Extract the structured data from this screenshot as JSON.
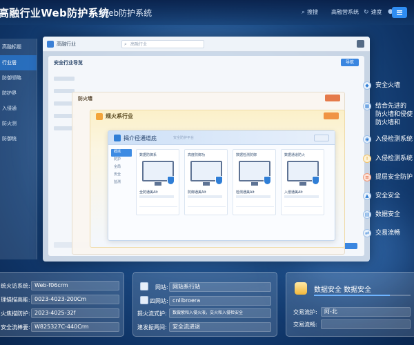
{
  "header": {
    "title": "高融行业Web防护系统",
    "subtitle": "Web防护系统",
    "nav": [
      {
        "icon": "search-icon",
        "label": "搜搜"
      },
      {
        "icon": "",
        "label": "高融营系统"
      },
      {
        "icon": "refresh-icon",
        "label": "速度"
      },
      {
        "icon": "user-icon",
        "label": ""
      }
    ]
  },
  "left_menu": {
    "header": "高融标题",
    "items": [
      "行业居",
      "防御领略",
      "防护界",
      "入侵通",
      "防火测",
      "防御统"
    ]
  },
  "window": {
    "title": "高融行业",
    "search_placeholder": "高融行业",
    "panel1_title": "安全行业导览",
    "panel1_button": "导航",
    "panel2_title": "防火墙",
    "panel3_title": "规火系行业",
    "panel4": {
      "title": "揭介径通道底",
      "subtitle": "安全防护平台",
      "side_items": [
        "概括",
        "防护",
        "全局",
        "安全",
        "监测"
      ],
      "cards": [
        {
          "title": "数据防御系",
          "label": "全防通美Alt"
        },
        {
          "title": "高度防御功",
          "label": "防御通美Alt"
        },
        {
          "title": "数据检测防御",
          "label": "检测通美Alt"
        },
        {
          "title": "数据通道防火",
          "label": "入侵通美Alt"
        }
      ]
    }
  },
  "features": [
    {
      "icon": "shield-icon",
      "label": "安全火墙"
    },
    {
      "icon": "firewall-icon",
      "label": "结合先进的\n防火墙和侵使\n防火墙和"
    },
    {
      "icon": "intrusion-icon",
      "label": "入侵检测系统"
    },
    {
      "icon": "alert-icon",
      "label": "入侵检测系统"
    },
    {
      "icon": "layer-icon",
      "label": "提层安全防护"
    },
    {
      "icon": "lock-icon",
      "label": "安全安全"
    },
    {
      "icon": "data-icon",
      "label": "数据安全"
    },
    {
      "icon": "flow-icon",
      "label": "交易流畅"
    }
  ],
  "info1": {
    "rows": [
      {
        "label": "统火访系统:",
        "value": "Web-f06crm"
      },
      {
        "label": "理描描高能:",
        "value": "0023-4023-200Cm"
      },
      {
        "label": "火焦描防护:",
        "value": "2023-4025-32f"
      },
      {
        "label": "安全流棒要:",
        "value": "W825327C-440Crm"
      }
    ]
  },
  "info2": {
    "rows": [
      {
        "label": "网站:",
        "value": "网站系行站"
      },
      {
        "label": "四网站:",
        "value": "cnlibroera"
      },
      {
        "label": "提火流式护:",
        "value": "数做紫和入侵火液，交火和入侵检安全"
      },
      {
        "label": "建发振两间:",
        "value": "安全流进退"
      }
    ]
  },
  "info3": {
    "title": "数据安全  数据安全",
    "rows": [
      {
        "label": "交易流护:",
        "value": "阿-北"
      },
      {
        "label": "交易流畅:",
        "value": ""
      }
    ]
  }
}
